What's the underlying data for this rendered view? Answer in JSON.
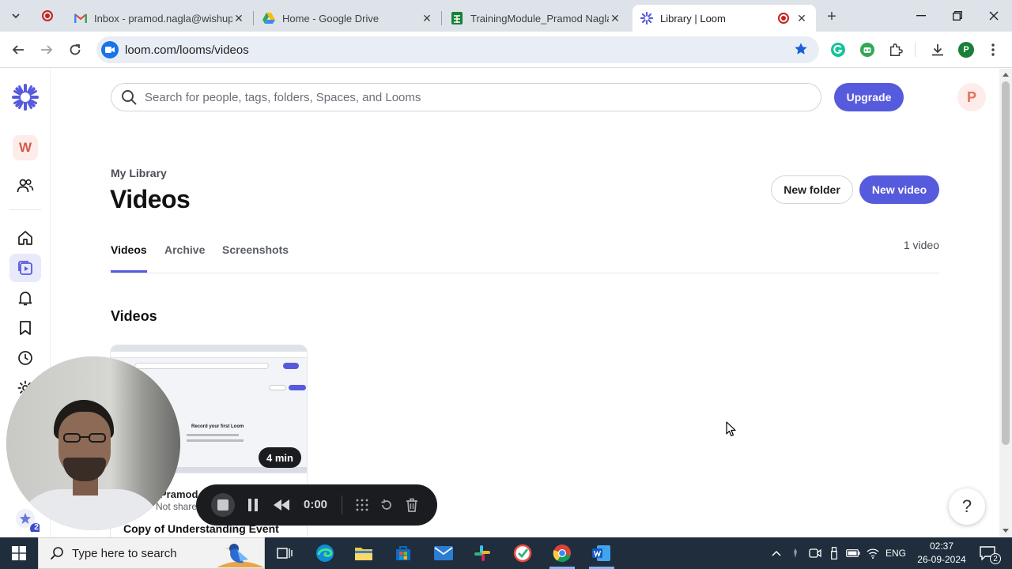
{
  "browser": {
    "tabs": [
      {
        "label": "Inbox - pramod.nagla@wishup.co",
        "active": false
      },
      {
        "label": "Home - Google Drive",
        "active": false
      },
      {
        "label": "TrainingModule_Pramod Nagla",
        "active": false
      },
      {
        "label": "Library | Loom",
        "active": true
      }
    ],
    "url": "loom.com/looms/videos",
    "profile_initial": "P"
  },
  "sidebar": {
    "workspace_initial": "W",
    "items": [
      {
        "name": "members",
        "icon": "users-icon"
      },
      {
        "name": "home",
        "icon": "home-icon"
      },
      {
        "name": "library",
        "icon": "video-library-icon",
        "active": true
      },
      {
        "name": "notifications",
        "icon": "bell-icon"
      },
      {
        "name": "watch-later",
        "icon": "bookmark-icon"
      },
      {
        "name": "history",
        "icon": "clock-icon"
      },
      {
        "name": "settings",
        "icon": "gear-icon"
      }
    ]
  },
  "header": {
    "search_placeholder": "Search for people, tags, folders, Spaces, and Looms",
    "upgrade_label": "Upgrade",
    "avatar_initial": "P"
  },
  "page": {
    "breadcrumb": "My Library",
    "title": "Videos",
    "new_folder_label": "New folder",
    "new_video_label": "New video",
    "tabs": [
      {
        "label": "Videos",
        "active": true
      },
      {
        "label": "Archive",
        "active": false
      },
      {
        "label": "Screenshots",
        "active": false
      }
    ],
    "video_count": "1 video",
    "section_title": "Videos"
  },
  "video_card": {
    "duration": "4 min",
    "owner": "Pramod Nagla",
    "sharing": "Not shared",
    "title": "Copy of Understanding Event",
    "thumb_heading": "Record your first Loom"
  },
  "recorder": {
    "timer": "0:00",
    "notification_count": "2"
  },
  "taskbar": {
    "search_placeholder": "Type here to search",
    "language": "ENG",
    "time": "02:37",
    "date": "26-09-2024",
    "notification_count": "2"
  },
  "colors": {
    "brand": "#565add",
    "tab_strip": "#dee3ea",
    "taskbar": "#1f2d3d"
  }
}
